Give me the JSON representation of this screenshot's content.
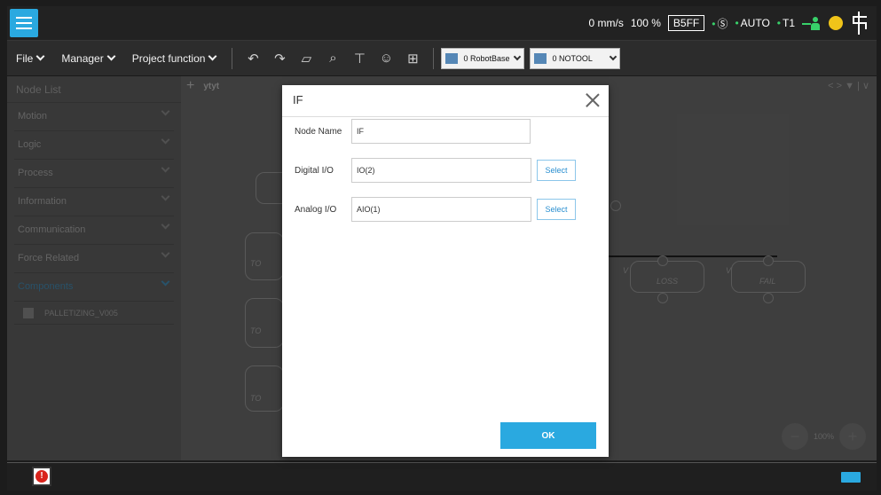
{
  "status": {
    "speed": "0 mm/s",
    "override": "100 %",
    "code": "B5FF",
    "mode_s": "Ⓢ",
    "mode_auto": "AUTO",
    "tool": "T1"
  },
  "toolbar": {
    "file": "File",
    "manager": "Manager",
    "project_function": "Project function",
    "robot_base": "0 RobotBase",
    "tool_select": "0 NOTOOL"
  },
  "node_list": {
    "title": "Node List",
    "items": [
      {
        "label": "Motion"
      },
      {
        "label": "Logic"
      },
      {
        "label": "Process"
      },
      {
        "label": "Information"
      },
      {
        "label": "Communication"
      },
      {
        "label": "Force Related"
      },
      {
        "label": "Components"
      }
    ],
    "sub_item": "PALLETIZING_V005"
  },
  "canvas": {
    "tab_name": "ytyt",
    "nav": "< > ▼ |  ∨",
    "labels": {
      "to1": "TO",
      "to2": "TO",
      "to3": "TO",
      "v1": "V",
      "v2": "V",
      "loss": "LOSS",
      "fail": "FAIL"
    },
    "zoom_level": "100%"
  },
  "dialog": {
    "title": "IF",
    "node_name_label": "Node Name",
    "node_name_value": "IF",
    "digital_io_label": "Digital I/O",
    "digital_io_value": "IO(2)",
    "analog_io_label": "Analog I/O",
    "analog_io_value": "AIO(1)",
    "select_label": "Select",
    "ok_label": "OK"
  },
  "colors": {
    "accent": "#2aa9e0",
    "status_green": "#38d16a",
    "alarm_red": "#d9241c"
  }
}
